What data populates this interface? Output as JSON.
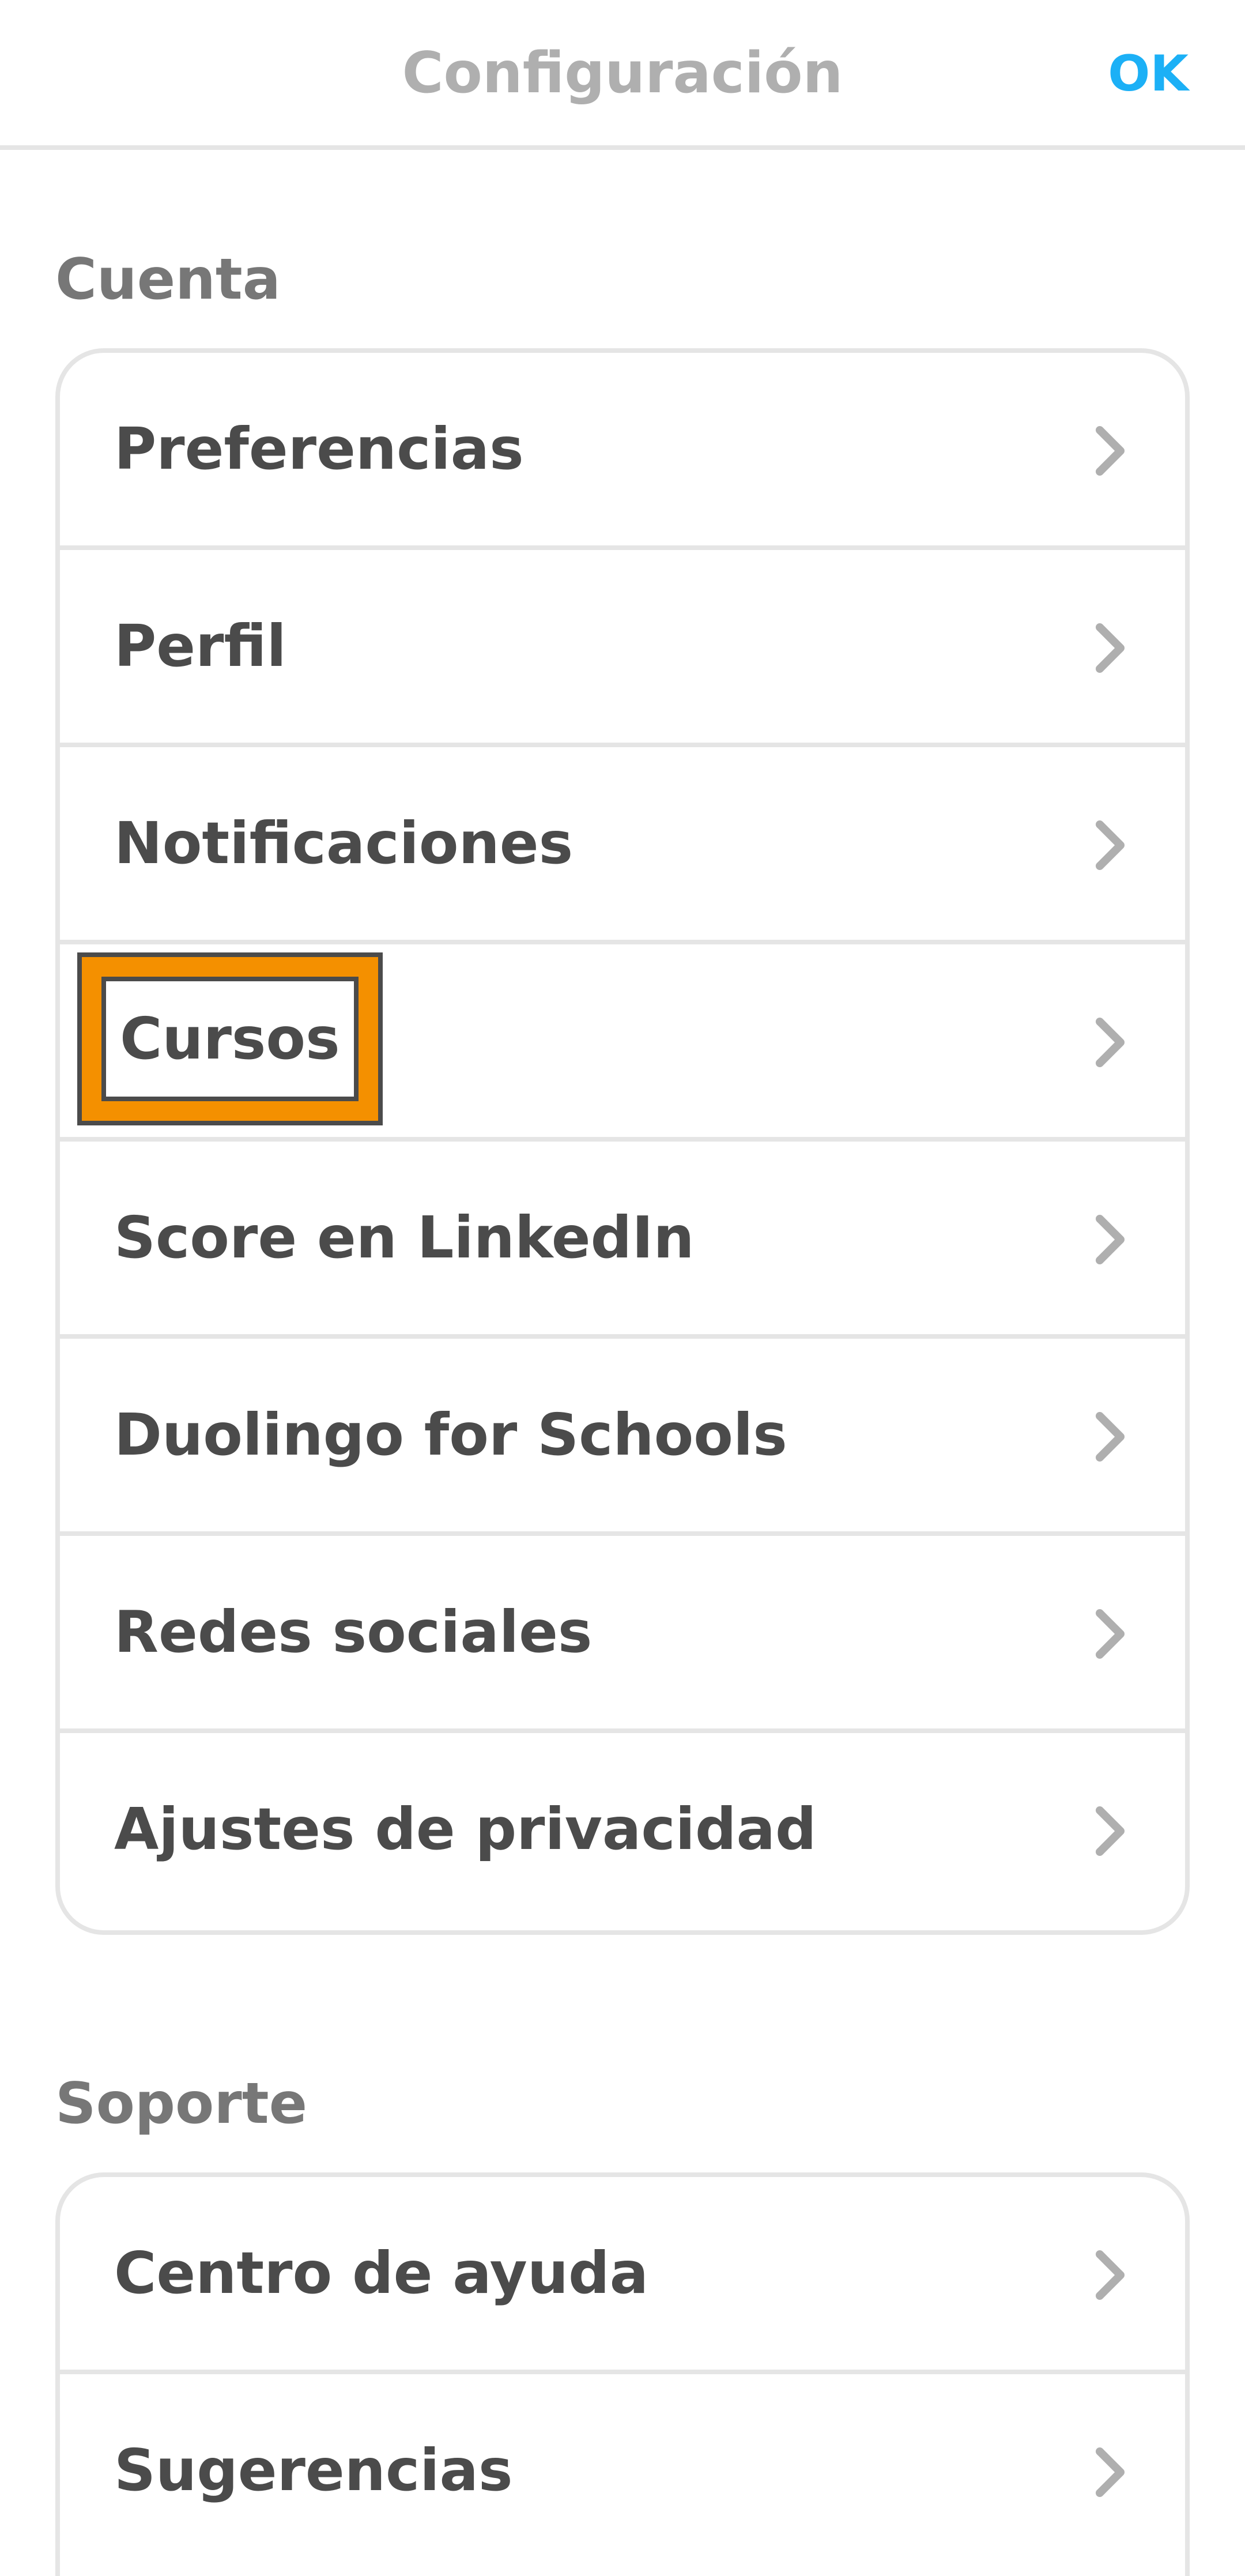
{
  "header": {
    "title": "Configuración",
    "ok_label": "OK"
  },
  "account": {
    "title": "Cuenta",
    "items": [
      {
        "label": "Preferencias"
      },
      {
        "label": "Perfil"
      },
      {
        "label": "Notificaciones"
      },
      {
        "label": "Cursos"
      },
      {
        "label": "Score en LinkedIn"
      },
      {
        "label": "Duolingo for Schools"
      },
      {
        "label": "Redes sociales"
      },
      {
        "label": "Ajustes de privacidad"
      }
    ]
  },
  "support": {
    "title": "Soporte",
    "items": [
      {
        "label": "Centro de ayuda"
      },
      {
        "label": "Sugerencias"
      }
    ]
  },
  "icons": {
    "row_chevron": "chevron-right-icon"
  },
  "colors": {
    "accent": "#1cb0f6",
    "highlight": "#f49000",
    "text": "#4b4b4b",
    "muted": "#afafaf",
    "section": "#777777",
    "border": "#e5e5e5"
  }
}
